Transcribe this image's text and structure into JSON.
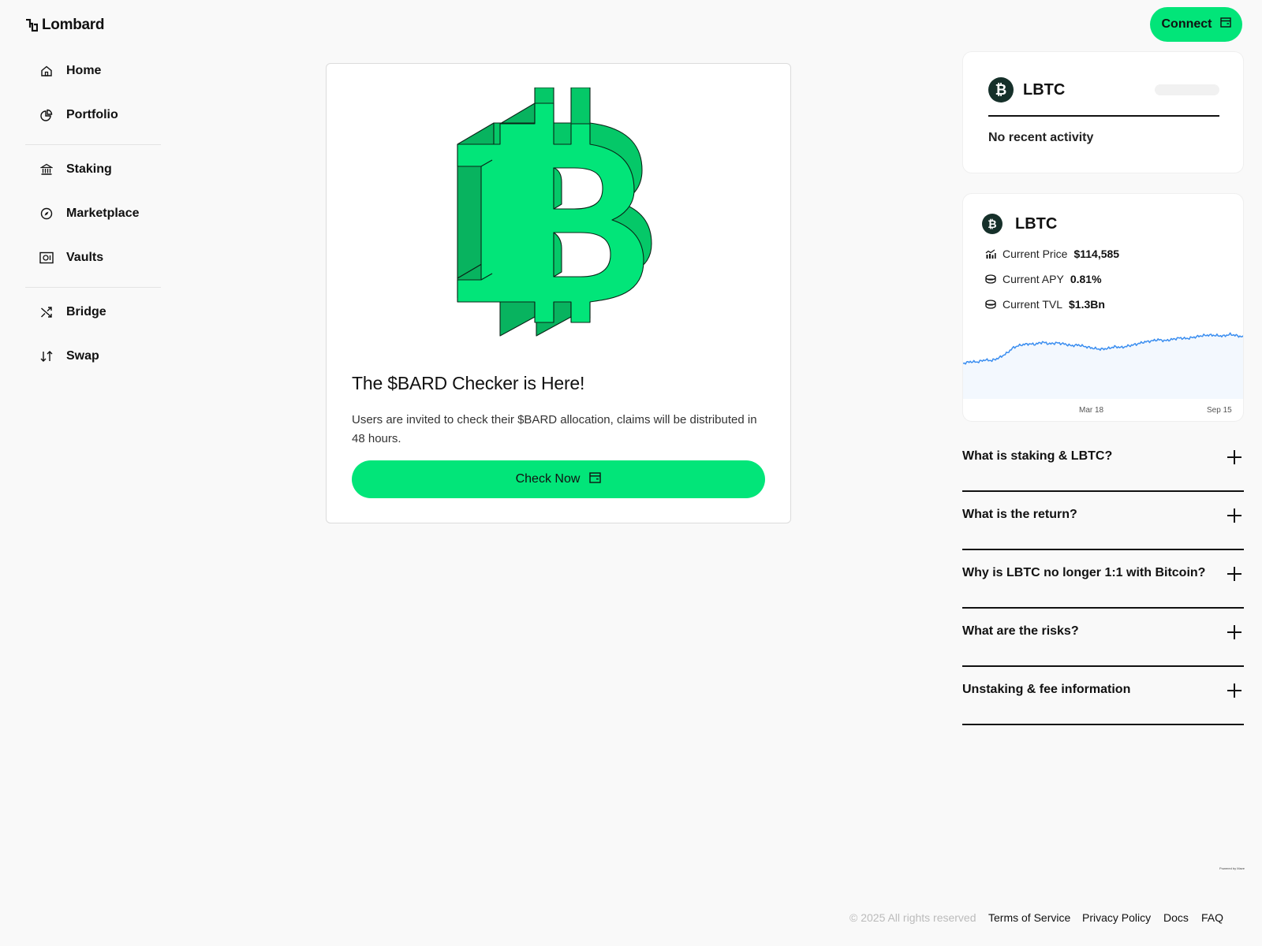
{
  "brand": {
    "name": "Lombard",
    "accent": "#02e579",
    "coin_bg": "#16302a",
    "chart_line": "#3b8ef0"
  },
  "header": {
    "connect_label": "Connect",
    "connect_icon": "wallet-icon"
  },
  "sidebar": {
    "items": [
      {
        "label": "Home",
        "icon": "home-icon"
      },
      {
        "label": "Portfolio",
        "icon": "pie-chart-icon"
      },
      {
        "label": "Staking",
        "icon": "bank-icon"
      },
      {
        "label": "Marketplace",
        "icon": "compass-icon"
      },
      {
        "label": "Vaults",
        "icon": "vault-icon"
      },
      {
        "label": "Bridge",
        "icon": "shuffle-icon"
      },
      {
        "label": "Swap",
        "icon": "swap-arrows-icon"
      }
    ]
  },
  "promo": {
    "image_icon": "bitcoin-3d-icon",
    "title": "The $BARD Checker is Here!",
    "description": "Users are invited to check their $BARD allocation, claims will be distributed in 48 hours.",
    "button_label": "Check Now",
    "button_icon": "wallet-icon"
  },
  "activity": {
    "token": "LBTC",
    "icon": "bitcoin-icon",
    "empty_text": "No recent activity"
  },
  "stats": {
    "token": "LBTC",
    "icon": "bitcoin-icon",
    "rows": [
      {
        "label": "Current Price",
        "value": "$114,585",
        "icon": "chart-icon"
      },
      {
        "label": "Current APY",
        "value": "0.81%",
        "icon": "coin-stack-icon"
      },
      {
        "label": "Current TVL",
        "value": "$1.3Bn",
        "icon": "coin-stack-icon"
      }
    ],
    "chart_data": {
      "type": "area",
      "title": "",
      "xlabel": "",
      "ylabel": "",
      "x_ticks": [
        "Mar 18",
        "Sep 15"
      ],
      "series": [
        {
          "values": [
            0.0,
            0.05,
            0.04,
            0.1,
            0.08,
            0.16,
            0.28,
            0.45,
            0.52,
            0.55,
            0.54,
            0.6,
            0.55,
            0.58,
            0.55,
            0.5,
            0.52,
            0.47,
            0.43,
            0.4,
            0.42,
            0.47,
            0.45,
            0.5,
            0.54,
            0.6,
            0.63,
            0.67,
            0.64,
            0.68,
            0.72,
            0.7,
            0.74,
            0.78,
            0.8,
            0.79,
            0.77,
            0.82,
            0.78,
            0.74
          ]
        }
      ],
      "ylim": [
        0,
        1
      ]
    }
  },
  "faq": [
    {
      "question": "What is staking & LBTC?"
    },
    {
      "question": "What is the return?"
    },
    {
      "question": "Why is LBTC no longer 1:1 with Bitcoin?"
    },
    {
      "question": "What are the risks?"
    },
    {
      "question": "Unstaking & fee information"
    }
  ],
  "powered_by": "Powered by Mave",
  "footer": {
    "copyright": "© 2025 All rights reserved",
    "links": [
      "Terms of Service",
      "Privacy Policy",
      "Docs",
      "FAQ"
    ]
  }
}
